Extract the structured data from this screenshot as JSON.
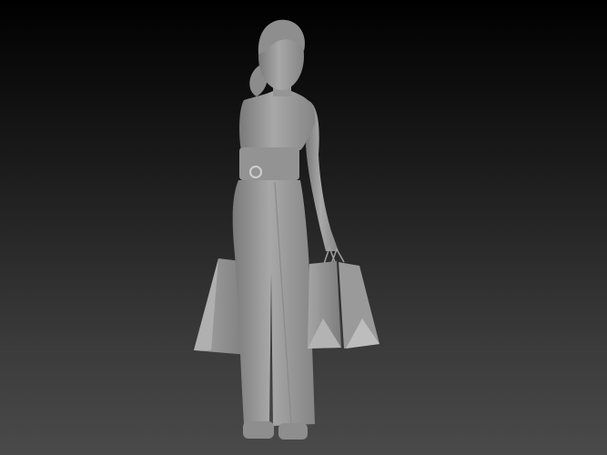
{
  "scene": {
    "subject": "figure-with-shopping-bags",
    "colors": {
      "background_top": "#000000",
      "background_bottom": "#4a4a4a",
      "model": "#9a9a9a",
      "shadow": "#6e6e6e",
      "highlight": "#b4b4b4"
    }
  }
}
